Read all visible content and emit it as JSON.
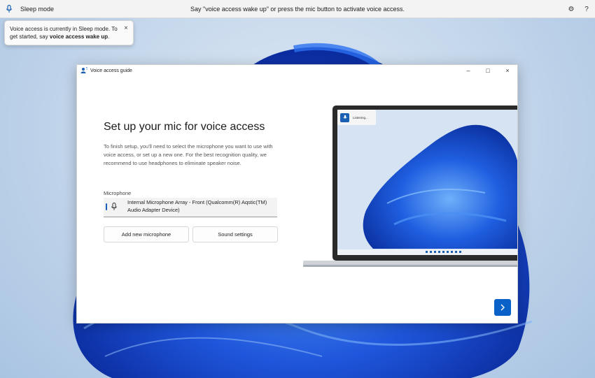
{
  "voice_bar": {
    "mode": "Sleep mode",
    "message": "Say \"voice access wake up\" or press the mic button to activate voice access."
  },
  "tooltip": {
    "text_before": "Voice access is currently in Sleep mode. To get started, say ",
    "text_bold": "voice access wake up",
    "text_after": ".",
    "close": "×"
  },
  "window": {
    "title": "Voice access guide",
    "controls": {
      "minimize": "–",
      "maximize": "□",
      "close": "×"
    }
  },
  "content": {
    "heading": "Set up your mic for voice access",
    "description": "To finish setup, you'll need to select the microphone you want to use with voice access, or set up a new one. For the best recognition quality, we recommend to use headphones to eliminate speaker noise.",
    "mic_label": "Microphone",
    "mic_value": "Internal Microphone Array - Front (Qualcomm(R) Aqstic(TM) Audio Adapter Device)",
    "add_button": "Add new microphone",
    "sound_button": "Sound settings"
  },
  "illustration": {
    "listening": "Listening..."
  },
  "colors": {
    "accent": "#0a62c8",
    "bloom_dark": "#0b2fb0",
    "bloom_light": "#3f86f0"
  }
}
